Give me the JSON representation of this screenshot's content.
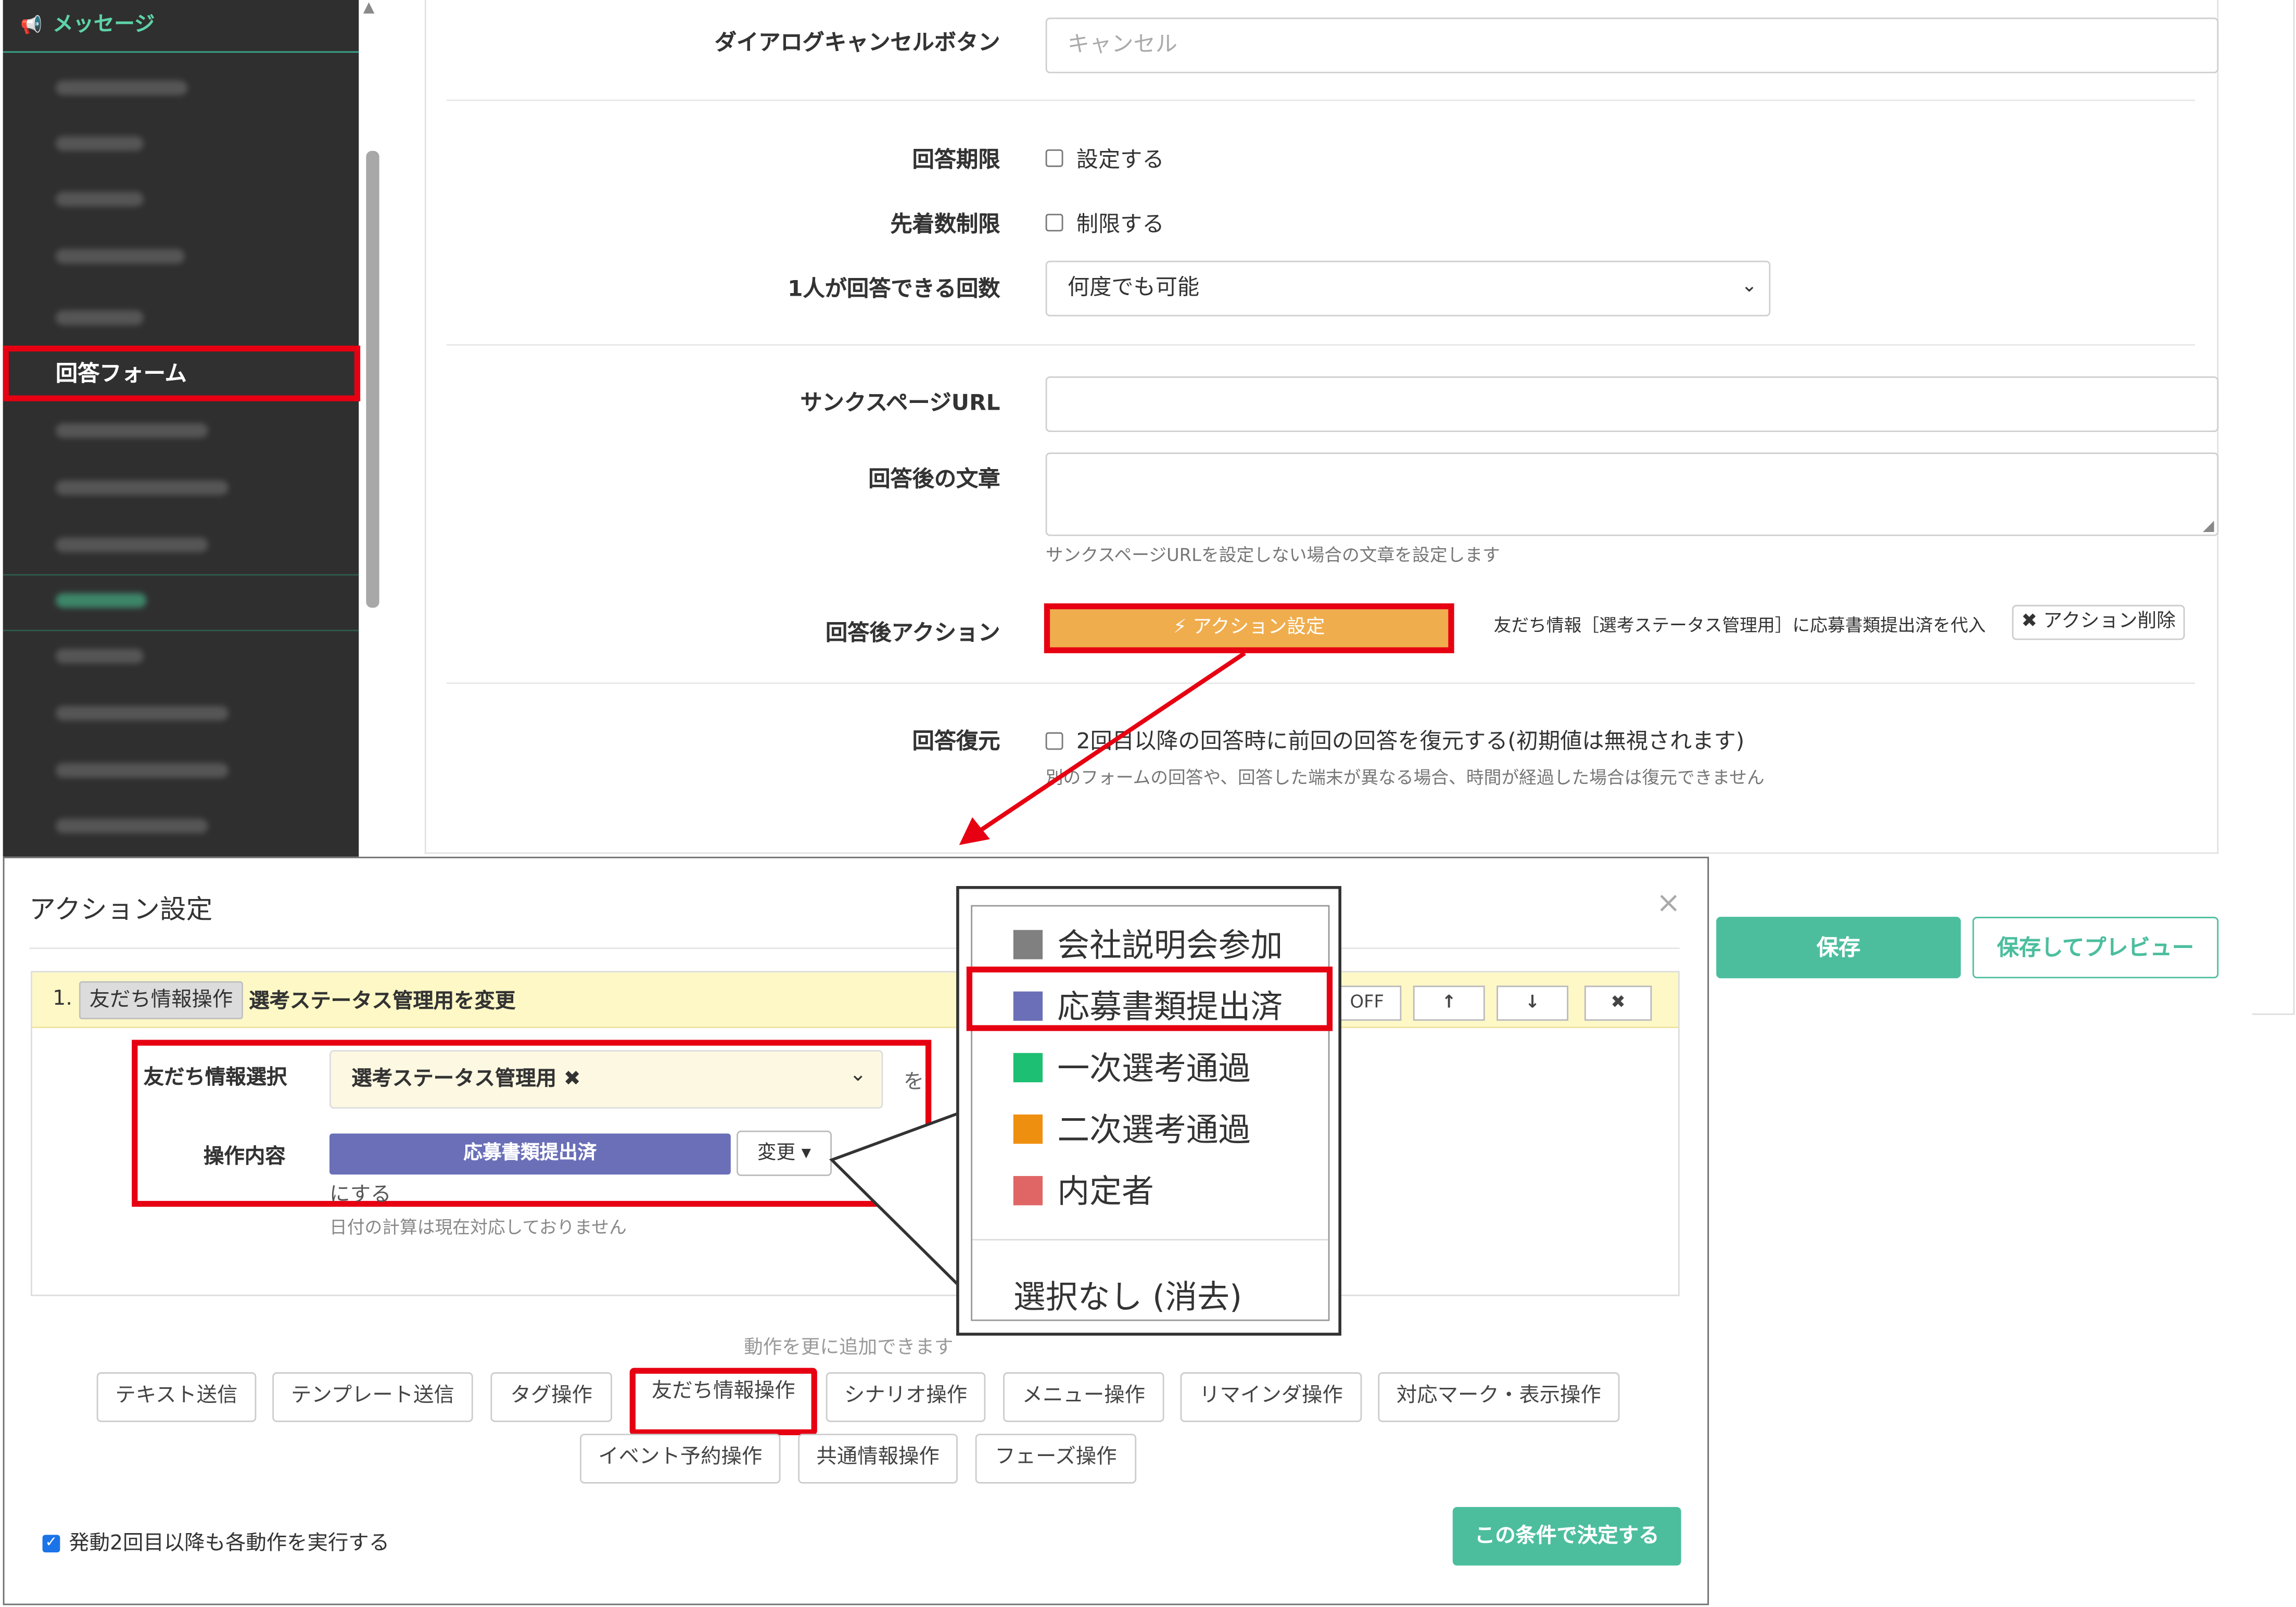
{
  "sidebar": {
    "header": "メッセージ",
    "active_item": "回答フォーム"
  },
  "form": {
    "cancel_button_label": "ダイアログキャンセルボタン",
    "cancel_button_placeholder": "キャンセル",
    "deadline_label": "回答期限",
    "deadline_check": "設定する",
    "first_come_label": "先着数制限",
    "first_come_check": "制限する",
    "per_person_label": "1人が回答できる回数",
    "per_person_value": "何度でも可能",
    "thanks_url_label": "サンクスページURL",
    "after_text_label": "回答後の文章",
    "after_text_help": "サンクスページURLを設定しない場合の文章を設定します",
    "after_action_label": "回答後アクション",
    "action_button": "⚡ アクション設定",
    "action_summary": "友だち情報［選考ステータス管理用］に応募書類提出済を代入",
    "action_delete": "✖ アクション削除",
    "restore_label": "回答復元",
    "restore_check": "2回目以降の回答時に前回の回答を復元する(初期値は無視されます)",
    "restore_help": "別のフォームの回答や、回答した端末が異なる場合、時間が経過した場合は復元できません",
    "save": "保存",
    "save_preview": "保存してプレビュー"
  },
  "modal": {
    "title": "アクション設定",
    "close": "×",
    "action_index": "1.",
    "action_tag": "友だち情報操作",
    "action_title": "選考ステータス管理用を変更",
    "off_label": "OFF",
    "up": "↑",
    "down": "↓",
    "remove": "✖",
    "friend_select_label": "友だち情報選択",
    "friend_select_value": "選考ステータス管理用 ✖",
    "wo": "を",
    "op_label": "操作内容",
    "op_value": "応募書類提出済",
    "change_button": "変更 ▾",
    "suru": "にする",
    "date_note": "日付の計算は現在対応しておりません",
    "add_note": "動作を更に追加できます",
    "op_buttons_row1": [
      "テキスト送信",
      "テンプレート送信",
      "タグ操作",
      "友だち情報操作",
      "シナリオ操作",
      "メニュー操作",
      "リマインダ操作",
      "対応マーク・表示操作"
    ],
    "op_buttons_row2": [
      "イベント予約操作",
      "共通情報操作",
      "フェーズ操作"
    ],
    "repeat_label": "発動2回目以降も各動作を実行する",
    "decide": "この条件で決定する"
  },
  "popup": {
    "options": [
      {
        "label": "会社説明会参加",
        "color": "#808080"
      },
      {
        "label": "応募書類提出済",
        "color": "#6a6fb8"
      },
      {
        "label": "一次選考通過",
        "color": "#1dbf73"
      },
      {
        "label": "二次選考通過",
        "color": "#ef8f10"
      },
      {
        "label": "内定者",
        "color": "#e06666"
      }
    ],
    "none": "選択なし (消去)"
  },
  "colors": {
    "accent_green": "#4cbe9e",
    "highlight_red": "#e60012",
    "action_orange": "#f0ad4e"
  }
}
